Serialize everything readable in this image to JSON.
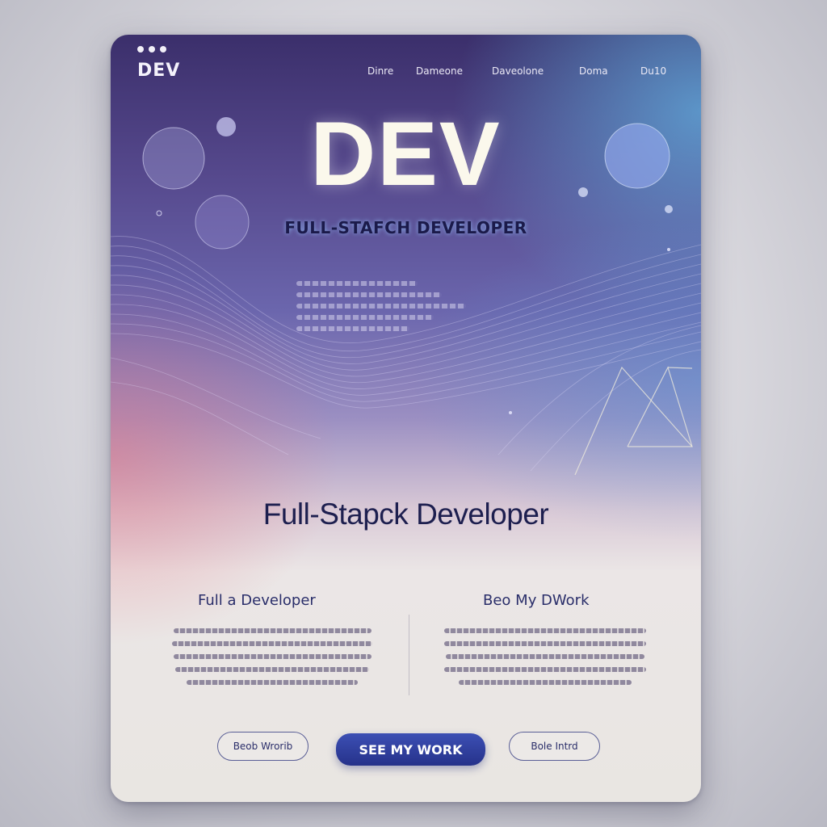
{
  "brand": {
    "logo": "DEV"
  },
  "nav": {
    "items": [
      {
        "label": "Dinre"
      },
      {
        "label": "Dameone"
      },
      {
        "label": "Daveolone"
      },
      {
        "label": "Doma"
      },
      {
        "label": "Du10"
      }
    ]
  },
  "hero": {
    "title": "DEV",
    "subtitle": "FULL-STAFCH DEVELOPER"
  },
  "section": {
    "title": "Full-Stapck Developer",
    "left_heading": "Full a Developer",
    "right_heading": "Beo My DWork"
  },
  "buttons": {
    "left": "Beob Wrorib",
    "primary": "SEE MY WORK",
    "right": "Bole Intrd"
  },
  "colors": {
    "accent": "#2f3c9e",
    "hero_title": "#fbf8ec",
    "heading_text": "#1d1f4f"
  }
}
